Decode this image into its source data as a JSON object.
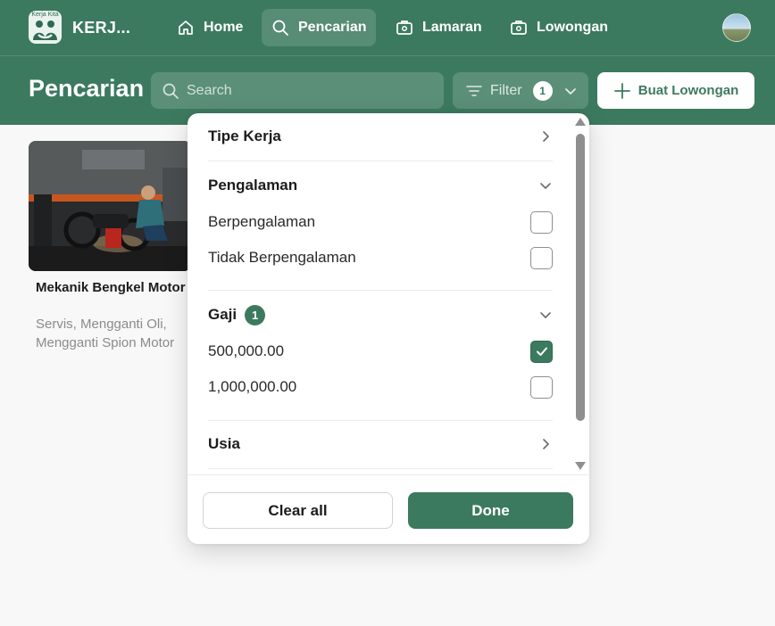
{
  "brand": {
    "logo_caption": "Kerja Kita",
    "name": "KERJ..."
  },
  "nav": {
    "items": [
      {
        "label": "Home",
        "icon": "home-icon"
      },
      {
        "label": "Pencarian",
        "icon": "search-icon",
        "active": true
      },
      {
        "label": "Lamaran",
        "icon": "briefcase-icon"
      },
      {
        "label": "Lowongan",
        "icon": "briefcase-icon"
      }
    ]
  },
  "header": {
    "title": "Pencarian",
    "search_placeholder": "Search",
    "filter_label": "Filter",
    "filter_count": "1",
    "new_job_label": "Buat Lowongan"
  },
  "card": {
    "title": "Mekanik Bengkel Motor",
    "description": "Servis, Mengganti Oli, Mengganti Spion Motor"
  },
  "filter_panel": {
    "sections": [
      {
        "title": "Tipe Kerja",
        "expanded": false
      },
      {
        "title": "Pengalaman",
        "expanded": true,
        "options": [
          {
            "label": "Berpengalaman",
            "checked": false
          },
          {
            "label": "Tidak Berpengalaman",
            "checked": false
          }
        ]
      },
      {
        "title": "Gaji",
        "badge": "1",
        "expanded": true,
        "options": [
          {
            "label": "500,000.00",
            "checked": true
          },
          {
            "label": "1,000,000.00",
            "checked": false
          }
        ]
      },
      {
        "title": "Usia",
        "expanded": false
      }
    ],
    "clear_label": "Clear all",
    "done_label": "Done"
  },
  "colors": {
    "primary": "#3c7a5f",
    "page_bg": "#f8f8f8",
    "text_muted": "#8b8b8b"
  }
}
